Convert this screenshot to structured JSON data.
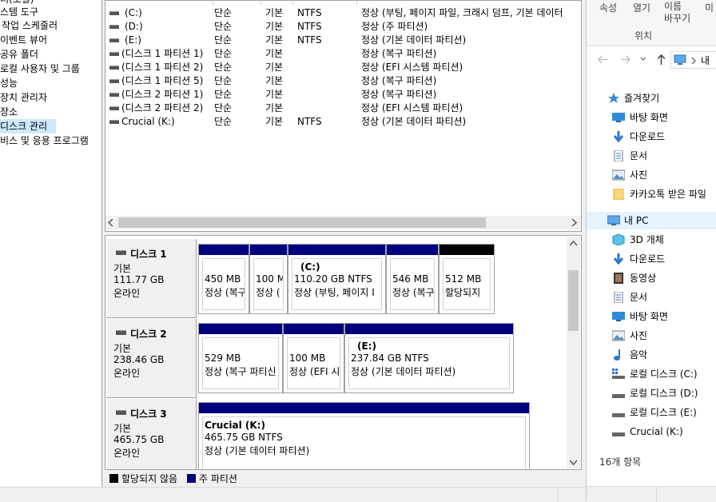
{
  "tree": [
    {
      "label": "터(로컬)"
    },
    {
      "label": "스템 도구"
    },
    {
      "label": "작업 스케줄러"
    },
    {
      "label": "이벤트 뷰어"
    },
    {
      "label": "공유 폴더"
    },
    {
      "label": "로컬 사용자 및 그룹"
    },
    {
      "label": "성능"
    },
    {
      "label": "장치 관리자"
    },
    {
      "label": "장소"
    },
    {
      "label": "디스크 관리"
    },
    {
      "label": "비스 및 응용 프로그램"
    }
  ],
  "volumes": [
    {
      "name": "(C:)",
      "layout": "단순",
      "type": "기본",
      "fs": "NTFS",
      "status": "정상 (부팅, 페이지 파일, 크래시 덤프, 기본 데이터"
    },
    {
      "name": "(D:)",
      "layout": "단순",
      "type": "기본",
      "fs": "NTFS",
      "status": "정상 (주 파티션)"
    },
    {
      "name": "(E:)",
      "layout": "단순",
      "type": "기본",
      "fs": "NTFS",
      "status": "정상 (기본 데이터 파티션)"
    },
    {
      "name": "(디스크 1 파티션 1)",
      "layout": "단순",
      "type": "기본",
      "fs": "",
      "status": "정상 (복구 파티션)"
    },
    {
      "name": "(디스크 1 파티션 2)",
      "layout": "단순",
      "type": "기본",
      "fs": "",
      "status": "정상 (EFI 시스템 파티션)"
    },
    {
      "name": "(디스크 1 파티션 5)",
      "layout": "단순",
      "type": "기본",
      "fs": "",
      "status": "정상 (복구 파티션)"
    },
    {
      "name": "(디스크 2 파티션 1)",
      "layout": "단순",
      "type": "기본",
      "fs": "",
      "status": "정상 (복구 파티션)"
    },
    {
      "name": "(디스크 2 파티션 2)",
      "layout": "단순",
      "type": "기본",
      "fs": "",
      "status": "정상 (EFI 시스템 파티션)"
    },
    {
      "name": "Crucial (K:)",
      "layout": "단순",
      "type": "기본",
      "fs": "NTFS",
      "status": "정상 (기본 데이터 파티션)"
    }
  ],
  "disks": [
    {
      "title": "디스크 1",
      "kind": "기본",
      "size": "111.77 GB",
      "state": "온라인",
      "parts": [
        {
          "name": "",
          "size": "450 MB",
          "status": "정상 (복구"
        },
        {
          "name": "",
          "size": "100 M",
          "status": "정상 ("
        },
        {
          "name": "(C:)",
          "size": "110.20 GB NTFS",
          "status": "정상 (부팅, 페이지 I"
        },
        {
          "name": "",
          "size": "546 MB",
          "status": "정상 (복구"
        },
        {
          "name": "",
          "size": "512 MB",
          "status": "할당되지"
        }
      ]
    },
    {
      "title": "디스크 2",
      "kind": "기본",
      "size": "238.46 GB",
      "state": "온라인",
      "parts": [
        {
          "name": "",
          "size": "529 MB",
          "status": "정상 (복구 파티신"
        },
        {
          "name": "",
          "size": "100 MB",
          "status": "정상 (EFI 시"
        },
        {
          "name": "(E:)",
          "size": "237.84 GB NTFS",
          "status": "정상 (기본 데이터 파티션)"
        }
      ]
    },
    {
      "title": "디스크 3",
      "kind": "기본",
      "size": "465.75 GB",
      "state": "온라인",
      "parts": [
        {
          "name": "Crucial  (K:)",
          "size": "465.75 GB NTFS",
          "status": "정상 (기본 데이터 파티션)"
        }
      ]
    }
  ],
  "legend": {
    "unallocated": "할당되지 않음",
    "primary": "주 파티션"
  },
  "colors": {
    "primary": "#00007f",
    "unallocated": "#000000",
    "selection": "#cce8ff"
  },
  "explorer": {
    "ribbon": {
      "properties": "속성",
      "open": "열기",
      "rename": "이름\n바꾸기",
      "more": "미",
      "location": "위치"
    },
    "address": "내",
    "nav": [
      {
        "label": "즐겨찾기",
        "icon": "star-icon"
      },
      {
        "label": "바탕 화면",
        "icon": "desktop-icon"
      },
      {
        "label": "다운로드",
        "icon": "download-icon"
      },
      {
        "label": "문서",
        "icon": "document-icon"
      },
      {
        "label": "사진",
        "icon": "picture-icon"
      },
      {
        "label": "카카오톡 받은 파일",
        "icon": "folder-icon"
      },
      {
        "label": "내 PC",
        "icon": "pc-icon"
      },
      {
        "label": "3D 개체",
        "icon": "cube-icon"
      },
      {
        "label": "다운로드",
        "icon": "download-icon"
      },
      {
        "label": "동영상",
        "icon": "video-icon"
      },
      {
        "label": "문서",
        "icon": "document-icon"
      },
      {
        "label": "바탕 화면",
        "icon": "desktop-icon"
      },
      {
        "label": "사진",
        "icon": "picture-icon"
      },
      {
        "label": "음악",
        "icon": "music-icon"
      },
      {
        "label": "로컬 디스크 (C:)",
        "icon": "system-drive-icon"
      },
      {
        "label": "로컬 디스크 (D:)",
        "icon": "drive-icon"
      },
      {
        "label": "로컬 디스크 (E:)",
        "icon": "drive-icon"
      },
      {
        "label": "Crucial (K:)",
        "icon": "drive-icon"
      }
    ],
    "item_count": "16개 항목"
  }
}
